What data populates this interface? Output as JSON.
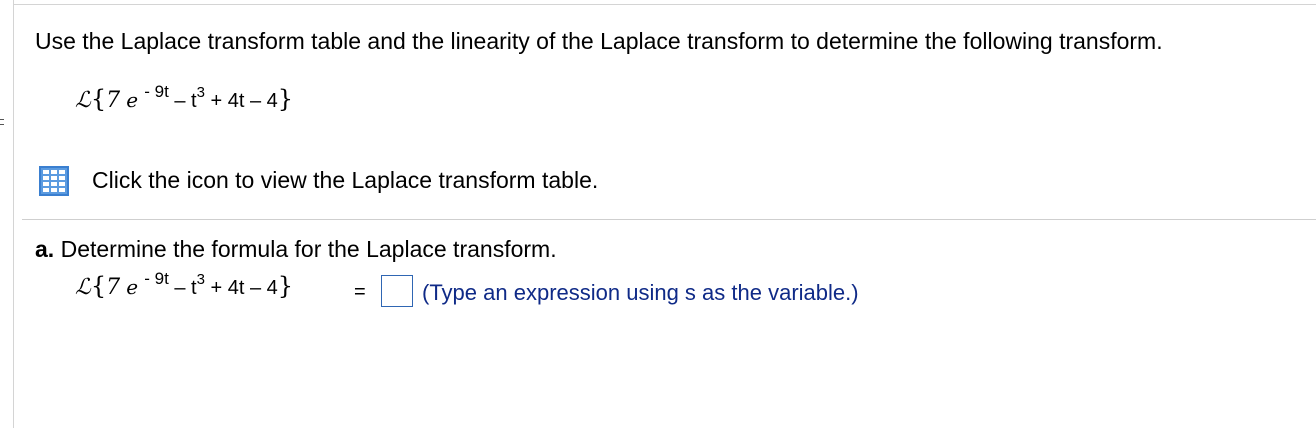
{
  "question": {
    "instruction": "Use the Laplace transform table and the linearity of the Laplace transform to determine the following transform.",
    "expression": {
      "operator": "ℒ",
      "open_brace": "{",
      "coefficient": "7",
      "base": "e",
      "exponent": "- 9t",
      "middle": " – t",
      "power": "3",
      "tail": " + 4t – 4",
      "close_brace": "}"
    },
    "table_link_text": "Click the icon to view the Laplace transform table.",
    "table_icon": "table-grid-icon"
  },
  "part_a": {
    "label": "a.",
    "prompt": "Determine the formula for the Laplace transform.",
    "equals": "=",
    "answer_value": "",
    "hint": "(Type an expression using s as the variable.)"
  },
  "colors": {
    "hint_text": "#0f2a87",
    "icon_blue": "#3a7fd0",
    "answer_border": "#2f66b3"
  }
}
